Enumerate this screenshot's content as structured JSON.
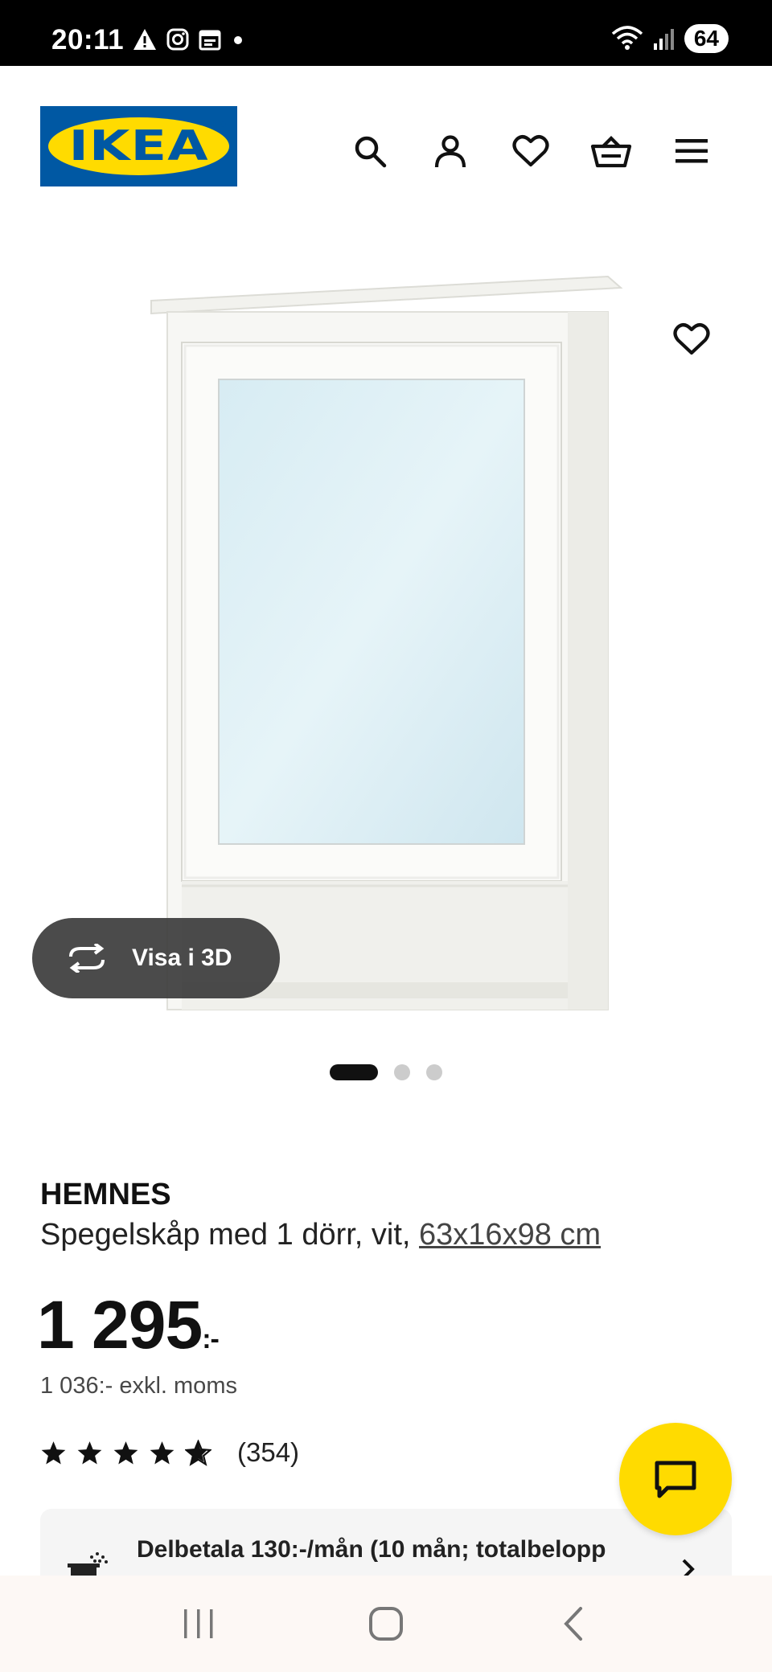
{
  "status_bar": {
    "time": "20:11",
    "left_icons": [
      "warning-icon",
      "instagram-icon",
      "calendar-icon",
      "dot-icon"
    ],
    "battery": "64"
  },
  "header": {
    "logo_text": "IKEA",
    "icons": [
      "search-icon",
      "account-icon",
      "heart-icon",
      "basket-icon",
      "menu-icon"
    ]
  },
  "gallery": {
    "view_3d_label": "Visa i 3D",
    "image_count": 3,
    "active_index": 0
  },
  "product": {
    "name": "HEMNES",
    "description": "Spegelskåp med 1 dörr, vit, ",
    "dimensions": "63x16x98 cm",
    "price": "1 295",
    "price_suffix": ":-",
    "price_ex_vat": "1 036:- exkl. moms",
    "rating_stars": 4.5,
    "rating_count": "(354)"
  },
  "payment": {
    "text": "Delbetala 130:-/mån (10 mån; totalbelopp"
  },
  "colors": {
    "ikea_blue": "#0058a3",
    "ikea_yellow": "#ffdb00"
  }
}
